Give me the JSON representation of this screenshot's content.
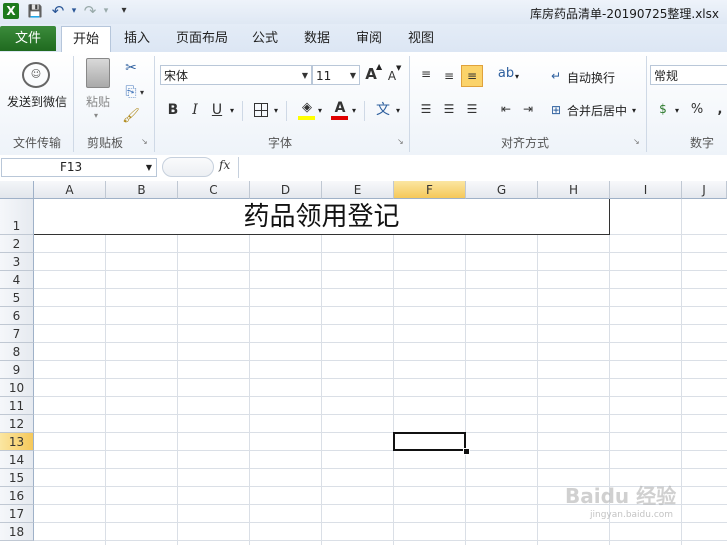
{
  "window": {
    "title": "库房药品清单-20190725整理.xlsx"
  },
  "quick_access": {
    "excel": "X",
    "save": "💾",
    "undo": "↶",
    "redo": "↷",
    "customize": "▾"
  },
  "tabs": [
    {
      "label": "文件"
    },
    {
      "label": "开始"
    },
    {
      "label": "插入"
    },
    {
      "label": "页面布局"
    },
    {
      "label": "公式"
    },
    {
      "label": "数据"
    },
    {
      "label": "审阅"
    },
    {
      "label": "视图"
    }
  ],
  "ribbon": {
    "send_wechat": "发送到微信",
    "paste": "粘贴",
    "font_name": "宋体",
    "font_size": "11",
    "grow_font": "A",
    "shrink_font": "A",
    "bold": "B",
    "italic": "I",
    "underline": "U",
    "font_color_glyph": "A",
    "phonetic": "文",
    "wrap_text": "自动换行",
    "merge_center": "合并后居中",
    "number_format": "常规",
    "percent": "%",
    "comma": ",",
    "groups": {
      "file_transfer": "文件传输",
      "clipboard": "剪贴板",
      "font": "字体",
      "alignment": "对齐方式",
      "number": "数字"
    },
    "colors": {
      "highlight": "#ffff00",
      "font_color": "#e00000"
    }
  },
  "formula_bar": {
    "name_box": "F13",
    "fx": "fx",
    "formula": ""
  },
  "sheet": {
    "columns": [
      "A",
      "B",
      "C",
      "D",
      "E",
      "F",
      "G",
      "H",
      "I",
      "J"
    ],
    "rows": [
      "1",
      "2",
      "3",
      "4",
      "5",
      "6",
      "7",
      "8",
      "9",
      "10",
      "11",
      "12",
      "13",
      "14",
      "15",
      "16",
      "17",
      "18"
    ],
    "selected_column": "F",
    "selected_row": "13",
    "merged_title": "药品领用登记"
  },
  "watermark": {
    "brand": "Baidu 经验",
    "url": "jingyan.baidu.com"
  }
}
